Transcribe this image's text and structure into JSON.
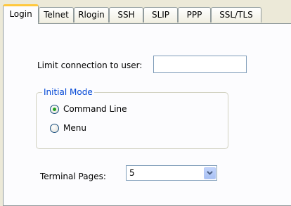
{
  "tabs": [
    {
      "label": "Login",
      "active": true
    },
    {
      "label": "Telnet",
      "active": false
    },
    {
      "label": "Rlogin",
      "active": false
    },
    {
      "label": "SSH",
      "active": false
    },
    {
      "label": "SLIP",
      "active": false
    },
    {
      "label": "PPP",
      "active": false
    },
    {
      "label": "SSL/TLS",
      "active": false
    }
  ],
  "limit_connection": {
    "label": "Limit connection to user:",
    "value": ""
  },
  "initial_mode": {
    "title": "Initial Mode",
    "options": [
      {
        "label": "Command Line",
        "checked": true
      },
      {
        "label": "Menu",
        "checked": false
      }
    ]
  },
  "terminal_pages": {
    "label": "Terminal Pages:",
    "value": "5"
  },
  "colors": {
    "window_background": "#ece9d8",
    "page_background": "#fcfcfe",
    "active_tab_accent": "#ffc83c",
    "group_title": "#0046d5",
    "radio_dot": "#21a121",
    "field_border": "#7f9db9"
  },
  "icons": {
    "combo_arrow": "chevron-down-icon"
  }
}
